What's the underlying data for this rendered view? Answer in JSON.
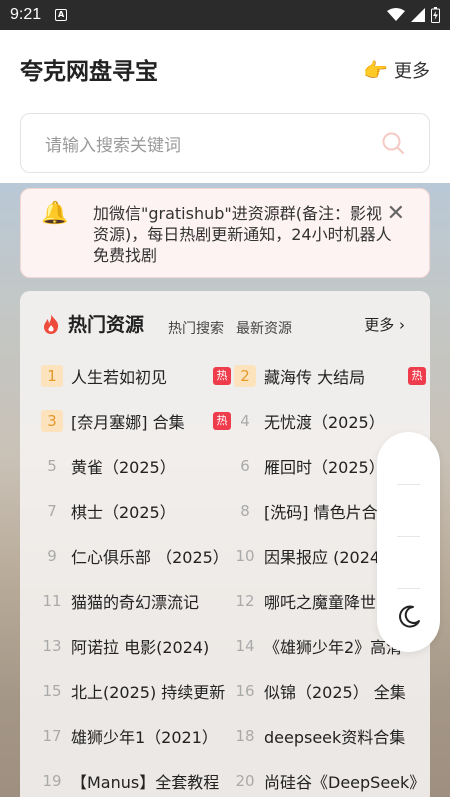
{
  "status": {
    "time": "9:21",
    "notif_icon": "A"
  },
  "header": {
    "title": "夸克网盘寻宝",
    "more_label": "更多",
    "more_icon": "pointing-hand-icon"
  },
  "search": {
    "placeholder": "请输入搜索关键词"
  },
  "notice": {
    "text": "加微信\"gratishub\"进资源群(备注：影视资源)，每日热剧更新通知，24小时机器人免费找剧",
    "close_label": "✕"
  },
  "hot": {
    "title": "热门资源",
    "tabs": [
      "热门搜索",
      "最新资源"
    ],
    "more_label": "更多 ›",
    "badge_label": "热",
    "items": [
      {
        "rank": "1",
        "name": "人生若如初见",
        "hot": true
      },
      {
        "rank": "2",
        "name": "藏海传 大结局",
        "hot": true
      },
      {
        "rank": "3",
        "name": "[奈月塞娜] 合集",
        "hot": true
      },
      {
        "rank": "4",
        "name": "无忧渡（2025）",
        "hot": false
      },
      {
        "rank": "5",
        "name": "黄雀（2025）",
        "hot": false
      },
      {
        "rank": "6",
        "name": "雁回时（2025）",
        "hot": false
      },
      {
        "rank": "7",
        "name": "棋士（2025）",
        "hot": false
      },
      {
        "rank": "8",
        "name": "[洗码] 情色片合集",
        "hot": false
      },
      {
        "rank": "9",
        "name": "仁心俱乐部 （2025）",
        "hot": false
      },
      {
        "rank": "10",
        "name": "因果报应 (2024)",
        "hot": false
      },
      {
        "rank": "11",
        "name": "猫猫的奇幻漂流记",
        "hot": false
      },
      {
        "rank": "12",
        "name": "哪吒之魔童降世",
        "hot": false
      },
      {
        "rank": "13",
        "name": "阿诺拉 电影(2024)",
        "hot": false
      },
      {
        "rank": "14",
        "name": "《雄狮少年2》高清",
        "hot": false
      },
      {
        "rank": "15",
        "name": "北上(2025) 持续更新",
        "hot": false
      },
      {
        "rank": "16",
        "name": "似锦（2025） 全集",
        "hot": false
      },
      {
        "rank": "17",
        "name": "雄狮少年1（2021）",
        "hot": false
      },
      {
        "rank": "18",
        "name": "deepseek资料合集",
        "hot": false
      },
      {
        "rank": "19",
        "name": "【Manus】全套教程",
        "hot": false
      },
      {
        "rank": "20",
        "name": "尚硅谷《DeepSeek》",
        "hot": false
      }
    ]
  },
  "colors": {
    "accent": "#ee3c4c",
    "rank_top_bg": "#fde3bd",
    "rank_top_fg": "#e39a2d"
  }
}
